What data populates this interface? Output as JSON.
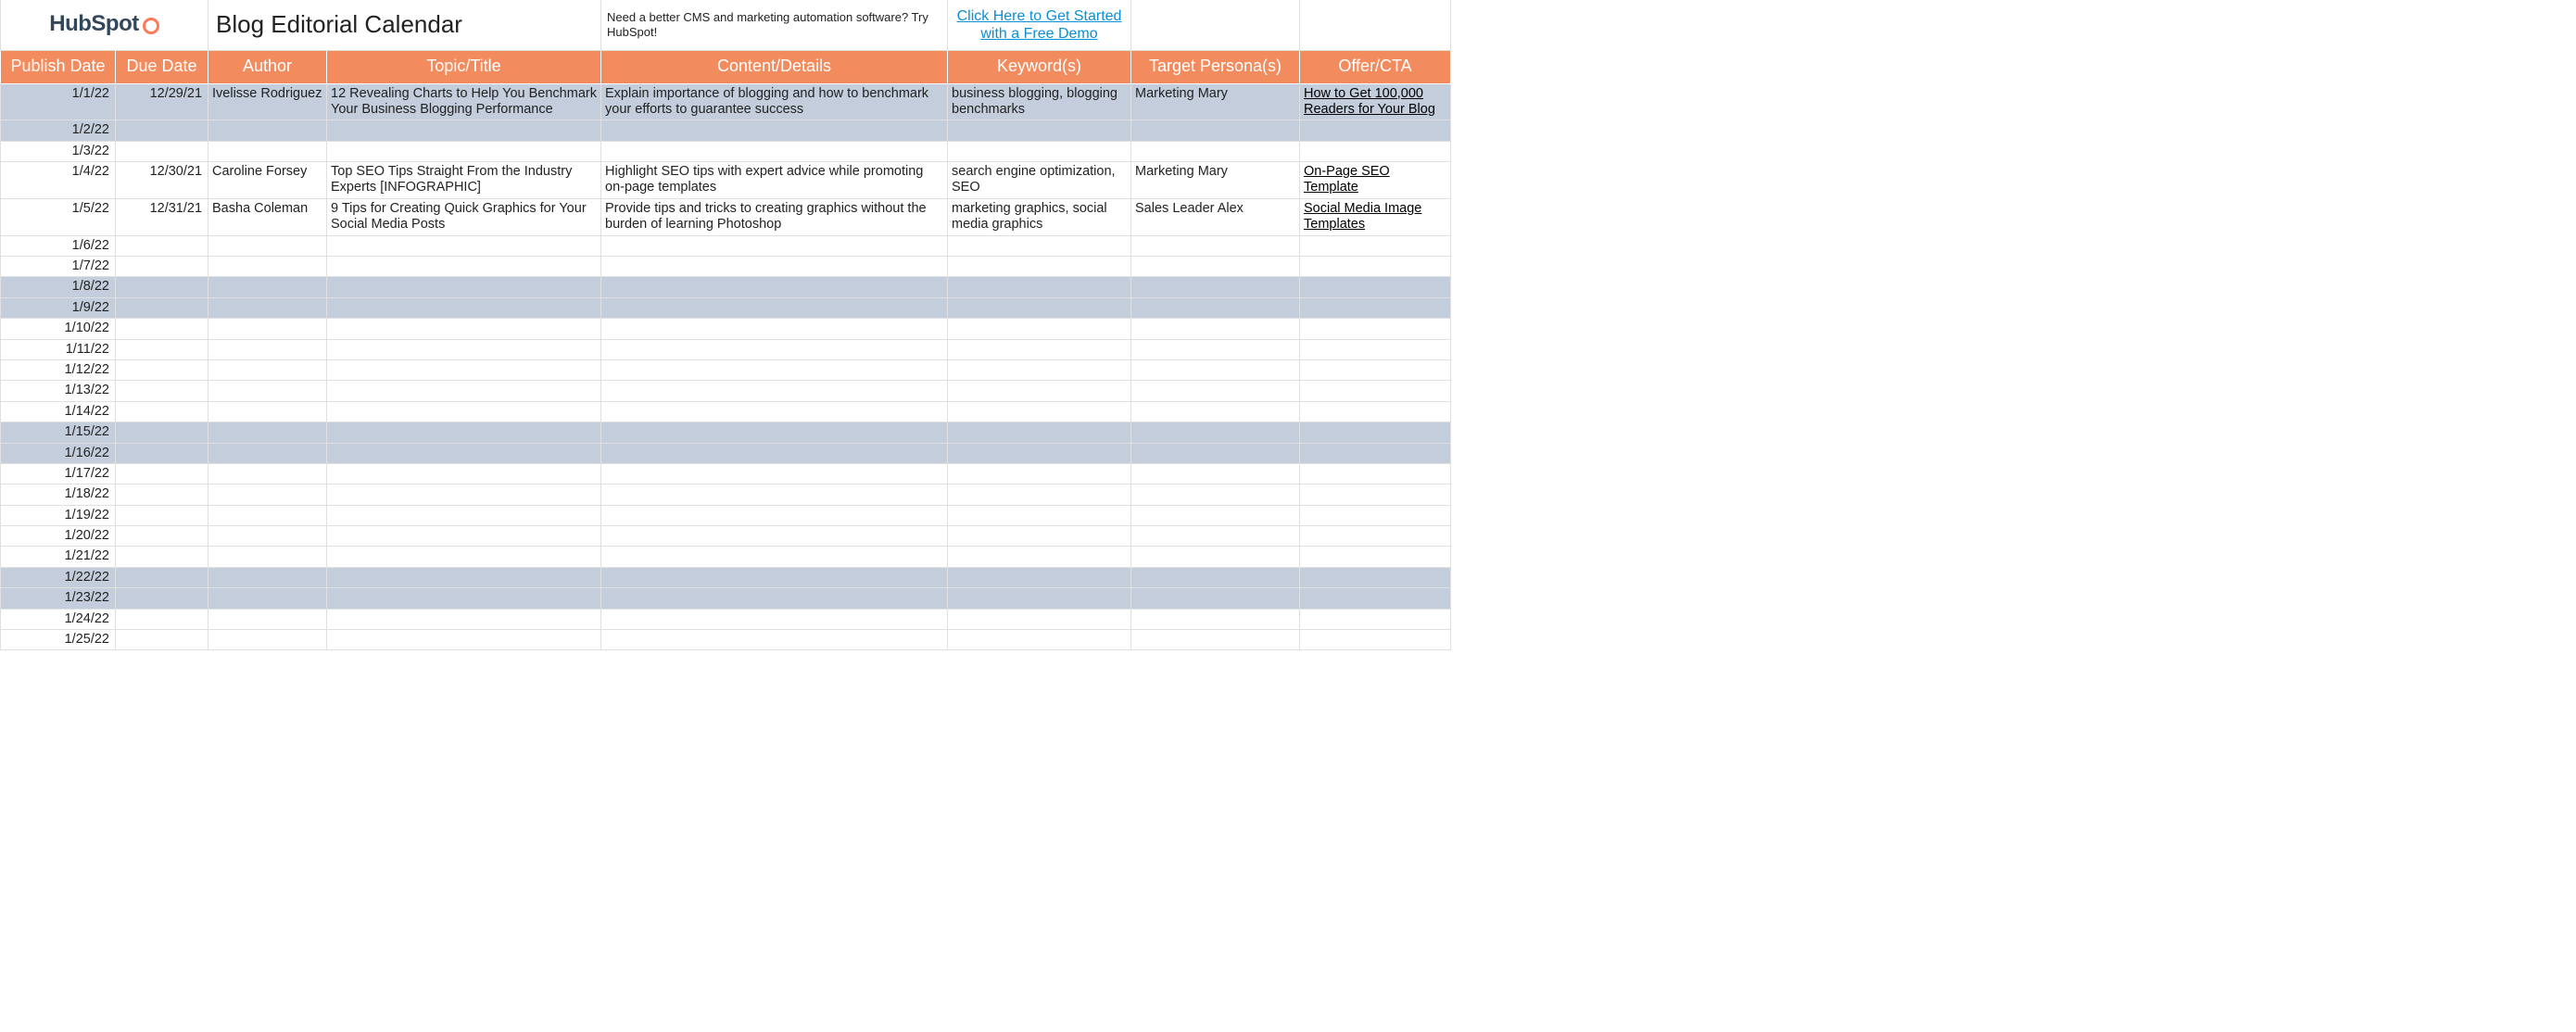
{
  "brand": {
    "name": "HubSpot"
  },
  "header": {
    "title": "Blog Editorial Calendar",
    "promo": "Need a better CMS and marketing automation software? Try HubSpot!",
    "cta_link": "Click Here to Get Started with a Free Demo"
  },
  "columns": {
    "publish_date": "Publish Date",
    "due_date": "Due Date",
    "author": "Author",
    "topic": "Topic/Title",
    "content": "Content/Details",
    "keywords": "Keyword(s)",
    "persona": "Target Persona(s)",
    "offer": "Offer/CTA"
  },
  "rows": [
    {
      "publish_date": "1/1/22",
      "due_date": "12/29/21",
      "author": "Ivelisse Rodriguez",
      "topic": "12 Revealing Charts to Help You Benchmark Your Business Blogging Performance",
      "content": "Explain importance of blogging and how to benchmark your efforts to guarantee success",
      "keywords": "business blogging, blogging benchmarks",
      "persona": "Marketing Mary",
      "offer": "How to Get 100,000 Readers for Your Blog",
      "offer_is_link": true,
      "shaded": true,
      "tall": true
    },
    {
      "publish_date": "1/2/22",
      "due_date": "",
      "author": "",
      "topic": "",
      "content": "",
      "keywords": "",
      "persona": "",
      "offer": "",
      "offer_is_link": false,
      "shaded": true,
      "tall": false
    },
    {
      "publish_date": "1/3/22",
      "due_date": "",
      "author": "",
      "topic": "",
      "content": "",
      "keywords": "",
      "persona": "",
      "offer": "",
      "offer_is_link": false,
      "shaded": false,
      "tall": false
    },
    {
      "publish_date": "1/4/22",
      "due_date": "12/30/21",
      "author": "Caroline Forsey",
      "topic": "Top SEO Tips Straight From the Industry Experts [INFOGRAPHIC]",
      "content": "Highlight SEO tips with expert advice while promoting on-page templates",
      "keywords": "search engine optimization, SEO",
      "persona": "Marketing Mary",
      "offer": "On-Page SEO Template",
      "offer_is_link": true,
      "shaded": false,
      "tall": true
    },
    {
      "publish_date": "1/5/22",
      "due_date": "12/31/21",
      "author": "Basha Coleman",
      "topic": "9 Tips for Creating Quick Graphics for Your Social Media Posts",
      "content": "Provide tips and tricks to creating graphics without the burden of learning Photoshop",
      "keywords": "marketing graphics, social media graphics",
      "persona": "Sales Leader Alex",
      "offer": "Social Media Image Templates",
      "offer_is_link": true,
      "shaded": false,
      "tall": true
    },
    {
      "publish_date": "1/6/22",
      "due_date": "",
      "author": "",
      "topic": "",
      "content": "",
      "keywords": "",
      "persona": "",
      "offer": "",
      "offer_is_link": false,
      "shaded": false,
      "tall": false
    },
    {
      "publish_date": "1/7/22",
      "due_date": "",
      "author": "",
      "topic": "",
      "content": "",
      "keywords": "",
      "persona": "",
      "offer": "",
      "offer_is_link": false,
      "shaded": false,
      "tall": false
    },
    {
      "publish_date": "1/8/22",
      "due_date": "",
      "author": "",
      "topic": "",
      "content": "",
      "keywords": "",
      "persona": "",
      "offer": "",
      "offer_is_link": false,
      "shaded": true,
      "tall": false
    },
    {
      "publish_date": "1/9/22",
      "due_date": "",
      "author": "",
      "topic": "",
      "content": "",
      "keywords": "",
      "persona": "",
      "offer": "",
      "offer_is_link": false,
      "shaded": true,
      "tall": false
    },
    {
      "publish_date": "1/10/22",
      "due_date": "",
      "author": "",
      "topic": "",
      "content": "",
      "keywords": "",
      "persona": "",
      "offer": "",
      "offer_is_link": false,
      "shaded": false,
      "tall": false
    },
    {
      "publish_date": "1/11/22",
      "due_date": "",
      "author": "",
      "topic": "",
      "content": "",
      "keywords": "",
      "persona": "",
      "offer": "",
      "offer_is_link": false,
      "shaded": false,
      "tall": false
    },
    {
      "publish_date": "1/12/22",
      "due_date": "",
      "author": "",
      "topic": "",
      "content": "",
      "keywords": "",
      "persona": "",
      "offer": "",
      "offer_is_link": false,
      "shaded": false,
      "tall": false
    },
    {
      "publish_date": "1/13/22",
      "due_date": "",
      "author": "",
      "topic": "",
      "content": "",
      "keywords": "",
      "persona": "",
      "offer": "",
      "offer_is_link": false,
      "shaded": false,
      "tall": false
    },
    {
      "publish_date": "1/14/22",
      "due_date": "",
      "author": "",
      "topic": "",
      "content": "",
      "keywords": "",
      "persona": "",
      "offer": "",
      "offer_is_link": false,
      "shaded": false,
      "tall": false
    },
    {
      "publish_date": "1/15/22",
      "due_date": "",
      "author": "",
      "topic": "",
      "content": "",
      "keywords": "",
      "persona": "",
      "offer": "",
      "offer_is_link": false,
      "shaded": true,
      "tall": false
    },
    {
      "publish_date": "1/16/22",
      "due_date": "",
      "author": "",
      "topic": "",
      "content": "",
      "keywords": "",
      "persona": "",
      "offer": "",
      "offer_is_link": false,
      "shaded": true,
      "tall": false
    },
    {
      "publish_date": "1/17/22",
      "due_date": "",
      "author": "",
      "topic": "",
      "content": "",
      "keywords": "",
      "persona": "",
      "offer": "",
      "offer_is_link": false,
      "shaded": false,
      "tall": false
    },
    {
      "publish_date": "1/18/22",
      "due_date": "",
      "author": "",
      "topic": "",
      "content": "",
      "keywords": "",
      "persona": "",
      "offer": "",
      "offer_is_link": false,
      "shaded": false,
      "tall": false
    },
    {
      "publish_date": "1/19/22",
      "due_date": "",
      "author": "",
      "topic": "",
      "content": "",
      "keywords": "",
      "persona": "",
      "offer": "",
      "offer_is_link": false,
      "shaded": false,
      "tall": false
    },
    {
      "publish_date": "1/20/22",
      "due_date": "",
      "author": "",
      "topic": "",
      "content": "",
      "keywords": "",
      "persona": "",
      "offer": "",
      "offer_is_link": false,
      "shaded": false,
      "tall": false
    },
    {
      "publish_date": "1/21/22",
      "due_date": "",
      "author": "",
      "topic": "",
      "content": "",
      "keywords": "",
      "persona": "",
      "offer": "",
      "offer_is_link": false,
      "shaded": false,
      "tall": false
    },
    {
      "publish_date": "1/22/22",
      "due_date": "",
      "author": "",
      "topic": "",
      "content": "",
      "keywords": "",
      "persona": "",
      "offer": "",
      "offer_is_link": false,
      "shaded": true,
      "tall": false
    },
    {
      "publish_date": "1/23/22",
      "due_date": "",
      "author": "",
      "topic": "",
      "content": "",
      "keywords": "",
      "persona": "",
      "offer": "",
      "offer_is_link": false,
      "shaded": true,
      "tall": false
    },
    {
      "publish_date": "1/24/22",
      "due_date": "",
      "author": "",
      "topic": "",
      "content": "",
      "keywords": "",
      "persona": "",
      "offer": "",
      "offer_is_link": false,
      "shaded": false,
      "tall": false
    },
    {
      "publish_date": "1/25/22",
      "due_date": "",
      "author": "",
      "topic": "",
      "content": "",
      "keywords": "",
      "persona": "",
      "offer": "",
      "offer_is_link": false,
      "shaded": false,
      "tall": false
    }
  ]
}
